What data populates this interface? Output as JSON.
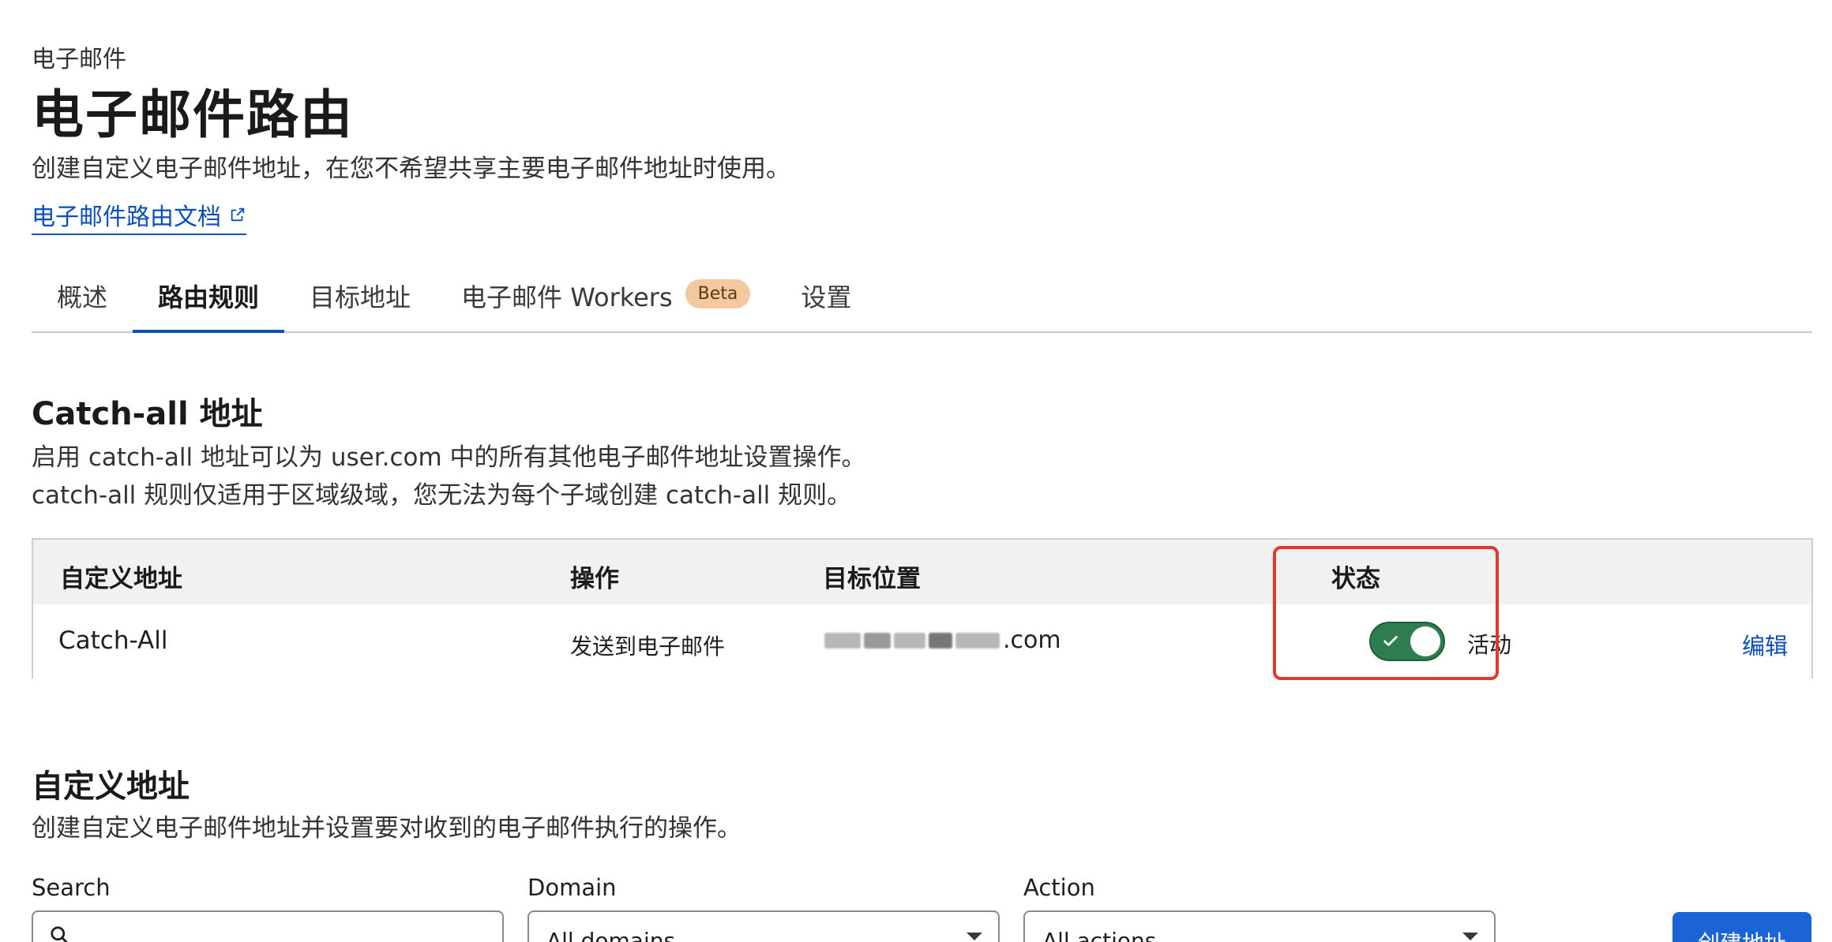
{
  "header": {
    "eyebrow": "电子邮件",
    "title": "电子邮件路由",
    "description": "创建自定义电子邮件地址，在您不希望共享主要电子邮件地址时使用。",
    "doc_link": "电子邮件路由文档"
  },
  "tabs": [
    {
      "label": "概述"
    },
    {
      "label": "路由规则",
      "active": true
    },
    {
      "label": "目标地址"
    },
    {
      "label": "电子邮件 Workers",
      "badge": "Beta"
    },
    {
      "label": "设置"
    }
  ],
  "catch_all": {
    "title": "Catch-all 地址",
    "desc_line1": "启用 catch-all 地址可以为 user.com 中的所有其他电子邮件地址设置操作。",
    "desc_line2": "catch-all 规则仅适用于区域级域，您无法为每个子域创建 catch-all 规则。",
    "columns": [
      "自定义地址",
      "操作",
      "目标位置",
      "状态"
    ],
    "row": {
      "address": "Catch-All",
      "action": "发送到电子邮件",
      "destination_suffix": ".com",
      "status_label": "活动",
      "enabled": true,
      "edit_label": "编辑"
    }
  },
  "custom": {
    "title": "自定义地址",
    "description": "创建自定义电子邮件地址并设置要对收到的电子邮件执行的操作。",
    "filters": {
      "search_label": "Search",
      "domain_label": "Domain",
      "domain_value": "All domains",
      "action_label": "Action",
      "action_value": "All actions"
    },
    "create_button": "创建地址"
  },
  "colors": {
    "link": "#0b4fb8",
    "toggle_on": "#2e7d4f",
    "highlight": "#e0392b",
    "primary_button": "#1a64d6",
    "beta_badge": "#f4c9a0"
  }
}
